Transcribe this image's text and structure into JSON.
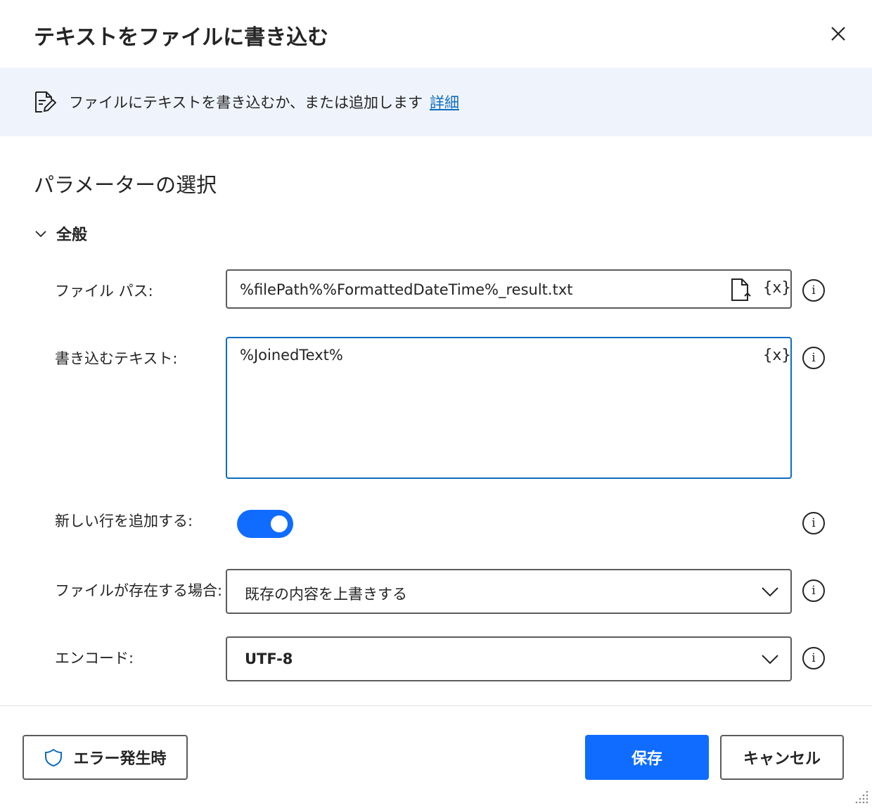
{
  "dialog": {
    "title": "テキストをファイルに書き込む"
  },
  "banner": {
    "text": "ファイルにテキストを書き込むか、または追加します",
    "link": "詳細"
  },
  "section": {
    "title": "パラメーターの選択"
  },
  "group": {
    "label": "全般"
  },
  "fields": {
    "file_path": {
      "label": "ファイル パス:",
      "value": "%filePath%%FormattedDateTime%_result.txt",
      "var_button": "{x}"
    },
    "text_to_write": {
      "label": "書き込むテキスト:",
      "value": "%JoinedText%",
      "var_button": "{x}"
    },
    "append_newline": {
      "label": "新しい行を追加する:",
      "checked": true
    },
    "if_file_exists": {
      "label": "ファイルが存在する場合:",
      "value": "既存の内容を上書きする"
    },
    "encoding": {
      "label": "エンコード:",
      "value": "UTF-8"
    },
    "info_glyph": "i"
  },
  "footer": {
    "error_button": "エラー発生時",
    "save_button": "保存",
    "cancel_button": "キャンセル"
  },
  "colors": {
    "accent": "#0f6cff",
    "link": "#0f6cbd",
    "banner_bg": "#eff4fc",
    "border": "#5c5c5c"
  },
  "icons": [
    "close-icon",
    "document-edit-icon",
    "chevron-down-icon",
    "file-upload-icon",
    "variable-icon",
    "info-icon",
    "shield-icon",
    "resize-grip-icon"
  ]
}
